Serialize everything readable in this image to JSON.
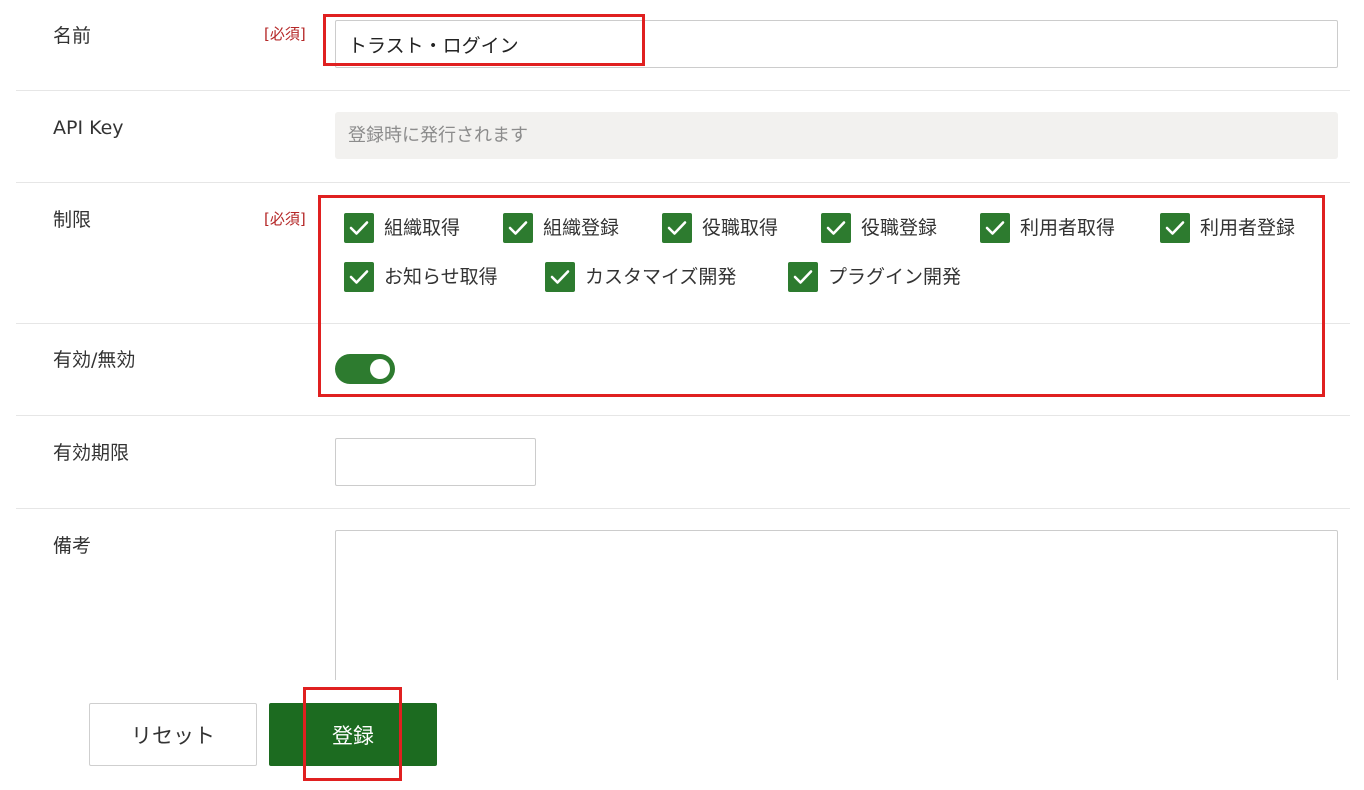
{
  "form": {
    "required_tag": "[必須]",
    "name": {
      "label": "名前",
      "value": "トラスト・ログイン"
    },
    "api_key": {
      "label": "API Key",
      "placeholder": "登録時に発行されます"
    },
    "restrictions": {
      "label": "制限",
      "options": [
        {
          "label": "組織取得",
          "checked": true
        },
        {
          "label": "組織登録",
          "checked": true
        },
        {
          "label": "役職取得",
          "checked": true
        },
        {
          "label": "役職登録",
          "checked": true
        },
        {
          "label": "利用者取得",
          "checked": true
        },
        {
          "label": "利用者登録",
          "checked": true
        },
        {
          "label": "お知らせ取得",
          "checked": true
        },
        {
          "label": "カスタマイズ開発",
          "checked": true
        },
        {
          "label": "プラグイン開発",
          "checked": true
        }
      ]
    },
    "enabled": {
      "label": "有効/無効",
      "on": true
    },
    "expiry": {
      "label": "有効期限",
      "value": ""
    },
    "notes": {
      "label": "備考",
      "value": ""
    }
  },
  "actions": {
    "reset_label": "リセット",
    "submit_label": "登録"
  },
  "colors": {
    "accent_green": "#2d7b2f",
    "submit_green": "#1c6b20",
    "required_red": "#b52828",
    "annotation_red": "#e02020"
  }
}
